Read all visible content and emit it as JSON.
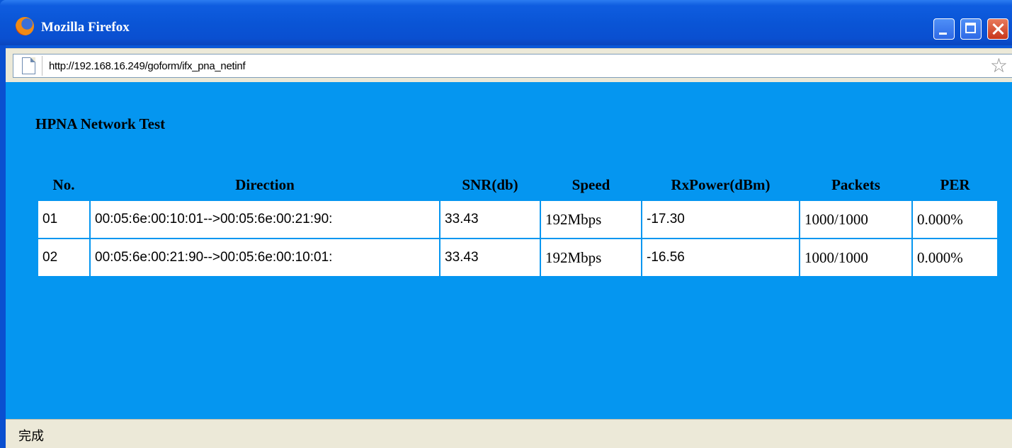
{
  "window": {
    "title": "Mozilla Firefox",
    "browser_icon": "firefox-icon",
    "controls": [
      "minimize-icon",
      "maximize-icon",
      "close-icon"
    ]
  },
  "address_bar": {
    "url": "http://192.168.16.249/goform/ifx_pna_netinf",
    "page_icon": "page-icon",
    "bookmark_icon": "star-icon"
  },
  "page": {
    "heading": "HPNA Network Test",
    "background_color": "#0596f0",
    "table": {
      "headers": [
        "No.",
        "Direction",
        "SNR(db)",
        "Speed",
        "RxPower(dBm)",
        "Packets",
        "PER"
      ],
      "rows": [
        [
          "01",
          "00:05:6e:00:10:01-->00:05:6e:00:21:90:",
          "33.43",
          "192Mbps",
          "-17.30",
          "1000/1000",
          "0.000%"
        ],
        [
          "02",
          "00:05:6e:00:21:90-->00:05:6e:00:10:01:",
          "33.43",
          "192Mbps",
          "-16.56",
          "1000/1000",
          "0.000%"
        ]
      ]
    }
  },
  "status_bar": {
    "text": "完成"
  }
}
